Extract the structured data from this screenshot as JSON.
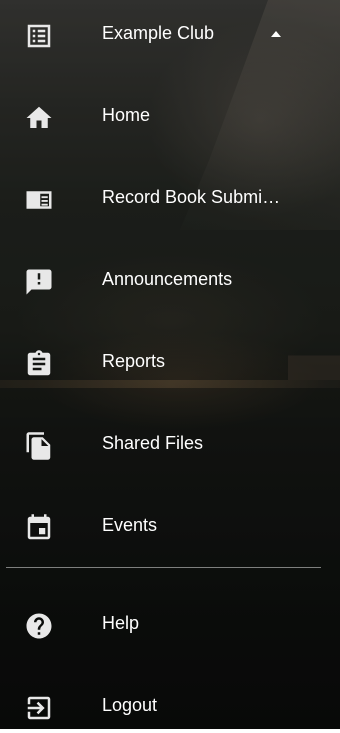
{
  "menu": {
    "club": {
      "label": "Example Club",
      "icon": "list-icon",
      "caret": "caret-up-icon"
    },
    "home": {
      "label": "Home",
      "icon": "home-icon"
    },
    "record_book": {
      "label": "Record Book Submissions",
      "icon": "record-book-icon"
    },
    "announcements": {
      "label": "Announcements",
      "icon": "announcement-icon"
    },
    "reports": {
      "label": "Reports",
      "icon": "clipboard-icon"
    },
    "shared_files": {
      "label": "Shared Files",
      "icon": "files-icon"
    },
    "events": {
      "label": "Events",
      "icon": "calendar-icon"
    },
    "help": {
      "label": "Help",
      "icon": "help-icon"
    },
    "logout": {
      "label": "Logout",
      "icon": "logout-icon"
    }
  }
}
